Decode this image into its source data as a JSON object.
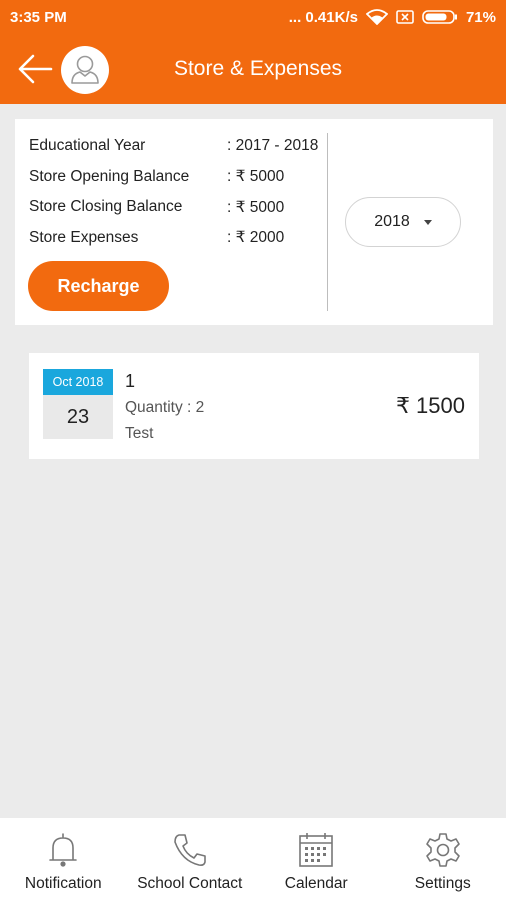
{
  "status_bar": {
    "time": "3:35 PM",
    "network_speed": "... 0.41K/s",
    "battery": "71%",
    "icons": [
      "wifi-icon",
      "sim-icon",
      "battery-icon"
    ]
  },
  "app_bar": {
    "title": "Store & Expenses",
    "back_icon": "arrow-left-icon",
    "avatar_icon": "user-avatar-icon"
  },
  "summary": {
    "rows": [
      {
        "label": "Educational Year",
        "value": ": 2017 - 2018"
      },
      {
        "label": "Store Opening Balance",
        "value": ": ₹ 5000"
      },
      {
        "label": "Store Closing Balance",
        "value": ": ₹ 5000"
      },
      {
        "label": "Store Expenses",
        "value": ": ₹ 2000"
      }
    ],
    "recharge_label": "Recharge",
    "year_selected": "2018"
  },
  "expenses": [
    {
      "month": "Oct 2018",
      "day": "23",
      "title": "1",
      "quantity": "Quantity : 2",
      "note": "Test",
      "amount": "₹ 1500"
    }
  ],
  "bottom_nav": [
    {
      "label": "Notification",
      "icon": "bell-icon"
    },
    {
      "label": "School Contact",
      "icon": "phone-icon"
    },
    {
      "label": "Calendar",
      "icon": "calendar-icon"
    },
    {
      "label": "Settings",
      "icon": "gear-icon"
    }
  ],
  "colors": {
    "primary": "#f26a0f",
    "date_badge": "#1aa7dd",
    "background": "#ebebeb"
  }
}
